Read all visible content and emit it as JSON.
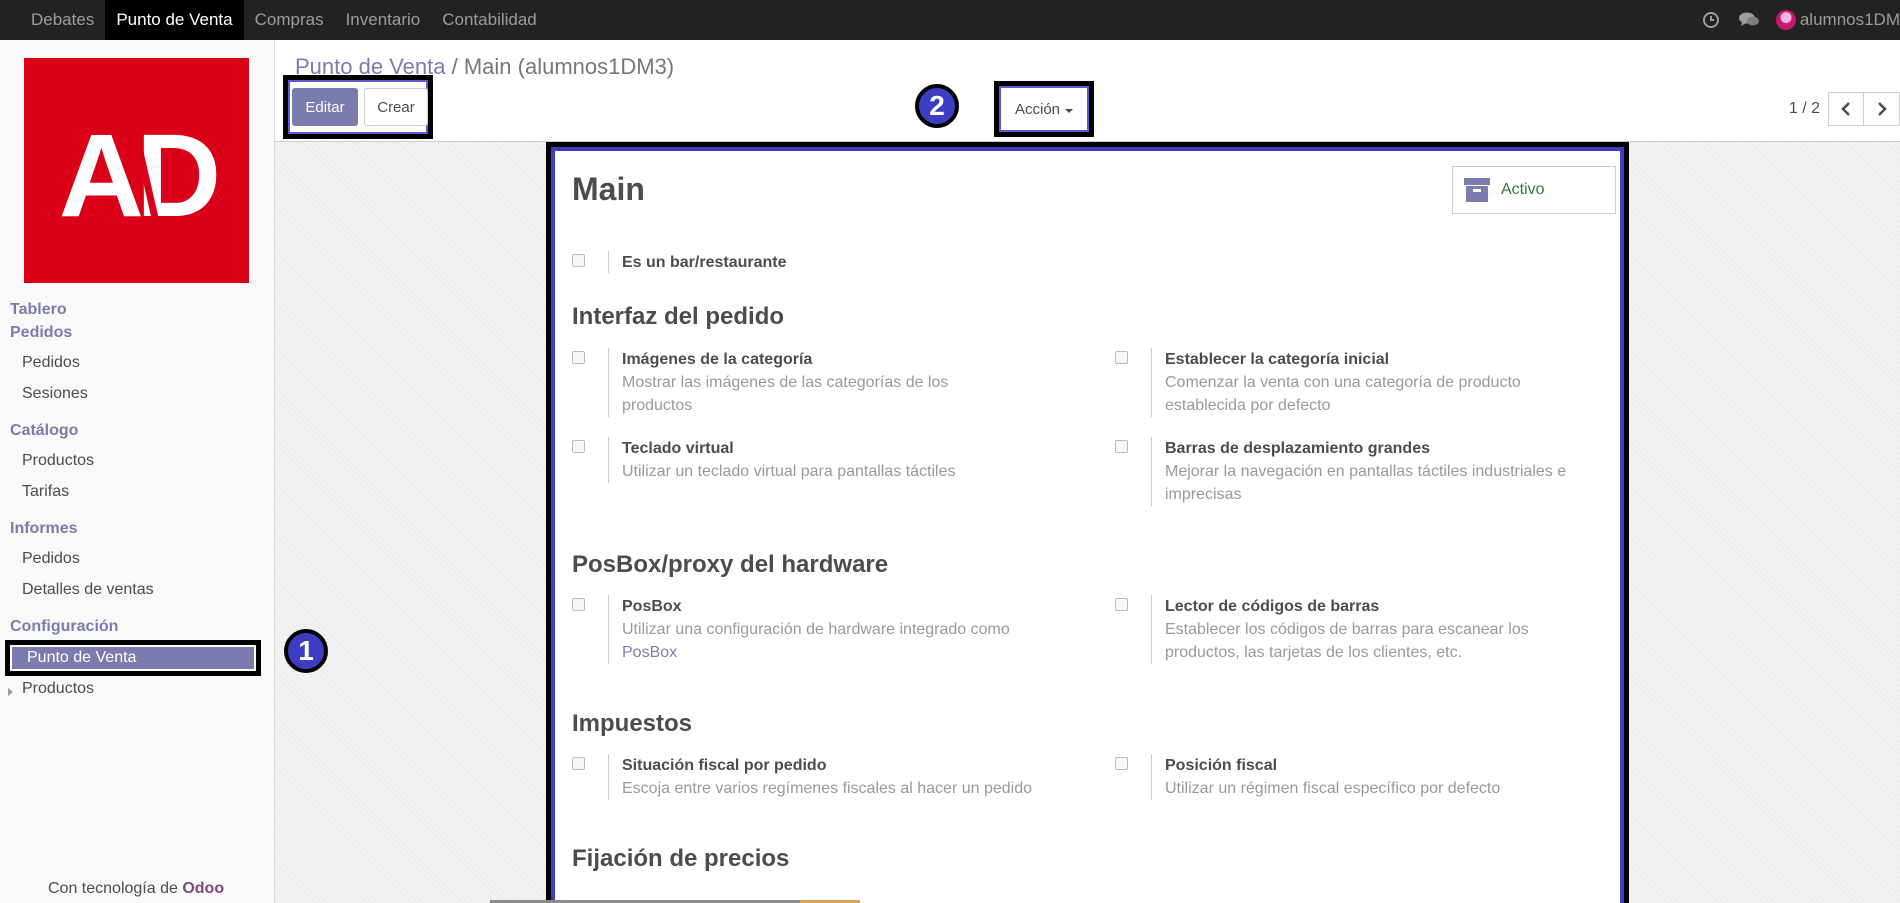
{
  "topbar": {
    "menu": [
      "Debates",
      "Punto de Venta",
      "Compras",
      "Inventario",
      "Contabilidad"
    ],
    "active_index": 1,
    "user": "alumnos1DM"
  },
  "sidebar": {
    "logo_text": "AD",
    "tablero": "Tablero",
    "pedidos_title": "Pedidos",
    "pedidos_items": [
      "Pedidos",
      "Sesiones"
    ],
    "catalogo_title": "Catálogo",
    "catalogo_items": [
      "Productos",
      "Tarifas"
    ],
    "informes_title": "Informes",
    "informes_items": [
      "Pedidos",
      "Detalles de ventas"
    ],
    "config_title": "Configuración",
    "config_items": [
      "Punto de Venta",
      "Productos"
    ],
    "powered_prefix": "Con tecnología de ",
    "powered_brand": "Odoo"
  },
  "control": {
    "breadcrumb_link": "Punto de Venta",
    "breadcrumb_sep": "/",
    "breadcrumb_current": "Main (alumnos1DM3)",
    "edit_label": "Editar",
    "create_label": "Crear",
    "action_label": "Acción",
    "pager_value": "1 / 2"
  },
  "callouts": [
    "1",
    "2"
  ],
  "form": {
    "title": "Main",
    "active_label": "Activo",
    "bar_restaurant": "Es un bar/restaurante",
    "sections": {
      "order": "Interfaz del pedido",
      "hardware": "PosBox/proxy del hardware",
      "taxes": "Impuestos",
      "pricing": "Fijación de precios"
    },
    "settings": {
      "cat_images": {
        "title": "Imágenes de la categoría",
        "desc": "Mostrar las imágenes de las categorías de los productos"
      },
      "start_cat": {
        "title": "Establecer la categoría inicial",
        "desc": "Comenzar la venta con una categoría de producto establecida por defecto"
      },
      "keyboard": {
        "title": "Teclado virtual",
        "desc": "Utilizar un teclado virtual para pantallas táctiles"
      },
      "scrollbars": {
        "title": "Barras de desplazamiento grandes",
        "desc": "Mejorar la navegación en pantallas táctiles industriales e imprecisas"
      },
      "posbox": {
        "title": "PosBox",
        "desc": "Utilizar una configuración de hardware integrado como ",
        "link": "PosBox"
      },
      "barcode": {
        "title": "Lector de códigos de barras",
        "desc": "Establecer los códigos de barras para escanear los productos, las tarjetas de los clientes, etc."
      },
      "fiscal_order": {
        "title": "Situación fiscal por pedido",
        "desc": "Escoja entre varios regímenes fiscales al hacer un pedido"
      },
      "fiscal_pos": {
        "title": "Posición fiscal",
        "desc": "Utilizar un régimen fiscal específico por defecto"
      }
    }
  }
}
